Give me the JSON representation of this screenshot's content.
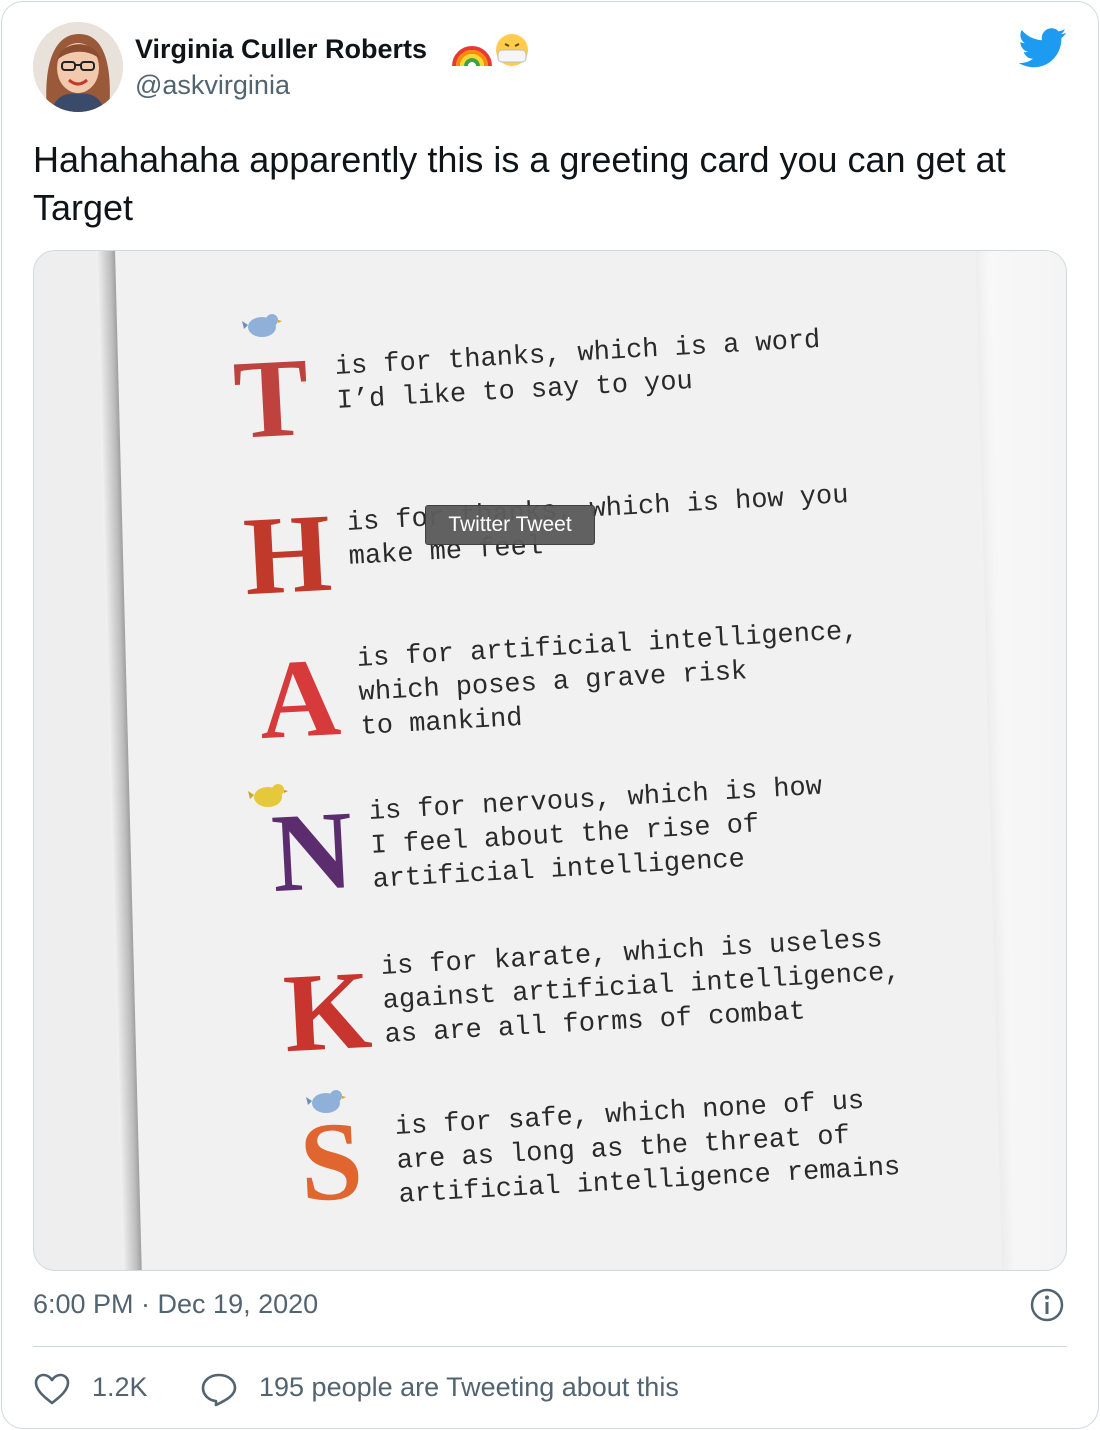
{
  "author": {
    "name": "Virginia Culler Roberts",
    "handle": "@askvirginia",
    "name_emoji": [
      "rainbow",
      "face-with-medical-mask"
    ]
  },
  "tweet": {
    "text": "Hahahahaha apparently this is a greeting card you can get at Target"
  },
  "card_verses": {
    "t": "is for thanks, which is a word\nI’d like to say to you",
    "h": "is for thanks, which is how you\nmake me feel",
    "a": "is for artificial intelligence,\nwhich poses a grave risk\nto mankind",
    "n": "is for nervous, which is how\nI feel about the rise of\nartificial intelligence",
    "k": "is for karate, which is useless\nagainst artificial intelligence,\nas are all forms of combat",
    "s": "is for safe, which none of us\nare as long as the threat of\nartificial intelligence remains"
  },
  "card_letters": [
    "T",
    "H",
    "A",
    "N",
    "K",
    "S"
  ],
  "tooltip": "Twitter Tweet",
  "meta": {
    "timestamp": "6:00 PM · Dec 19, 2020"
  },
  "engagement": {
    "likes": "1.2K",
    "replies_text": "195 people are Tweeting about this"
  },
  "colors": {
    "twitter_blue": "#1d9bf0",
    "text_secondary": "#536471",
    "border": "#cfd9de"
  }
}
